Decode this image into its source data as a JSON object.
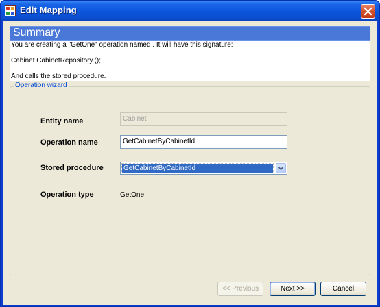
{
  "window": {
    "title": "Edit Mapping",
    "icons": {
      "app": "app-window-icon",
      "close": "close-icon"
    }
  },
  "summary": {
    "heading": "Summary",
    "line1": "You are creating a \"GetOne\" operation named . It will have this signature:",
    "line2": "Cabinet CabinetRepository.();",
    "line3": "And calls the  stored procedure."
  },
  "wizard": {
    "legend": "Operation wizard",
    "entity_name": {
      "label": "Entity name",
      "value": "Cabinet"
    },
    "operation_name": {
      "label": "Operation name",
      "value": "GetCabinetByCabinetId"
    },
    "stored_procedure": {
      "label": "Stored procedure",
      "selected": "GetCabinetByCabinetId"
    },
    "operation_type": {
      "label": "Operation type",
      "value": "GetOne"
    }
  },
  "buttons": {
    "previous": "<< Previous",
    "next": "Next >>",
    "cancel": "Cancel"
  },
  "colors": {
    "title_bar": "#0a55dc",
    "summary_header": "#4a78d8",
    "dialog_bg": "#ece9d8",
    "selection": "#316ac5",
    "legend_text": "#0046d5"
  }
}
